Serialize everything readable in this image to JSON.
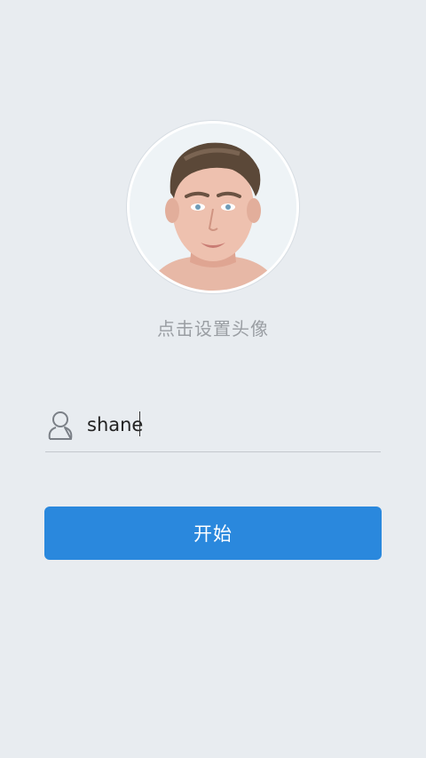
{
  "avatar": {
    "description": "",
    "set_avatar_label": "点击设置头像"
  },
  "login": {
    "username_value": "shane",
    "start_label": "开始"
  },
  "icons": {
    "user": "user-outline-icon"
  },
  "colors": {
    "background": "#e8ecf0",
    "primary": "#2a88dd",
    "hint_text": "#9a9ea3",
    "underline": "#c3c8cd"
  }
}
